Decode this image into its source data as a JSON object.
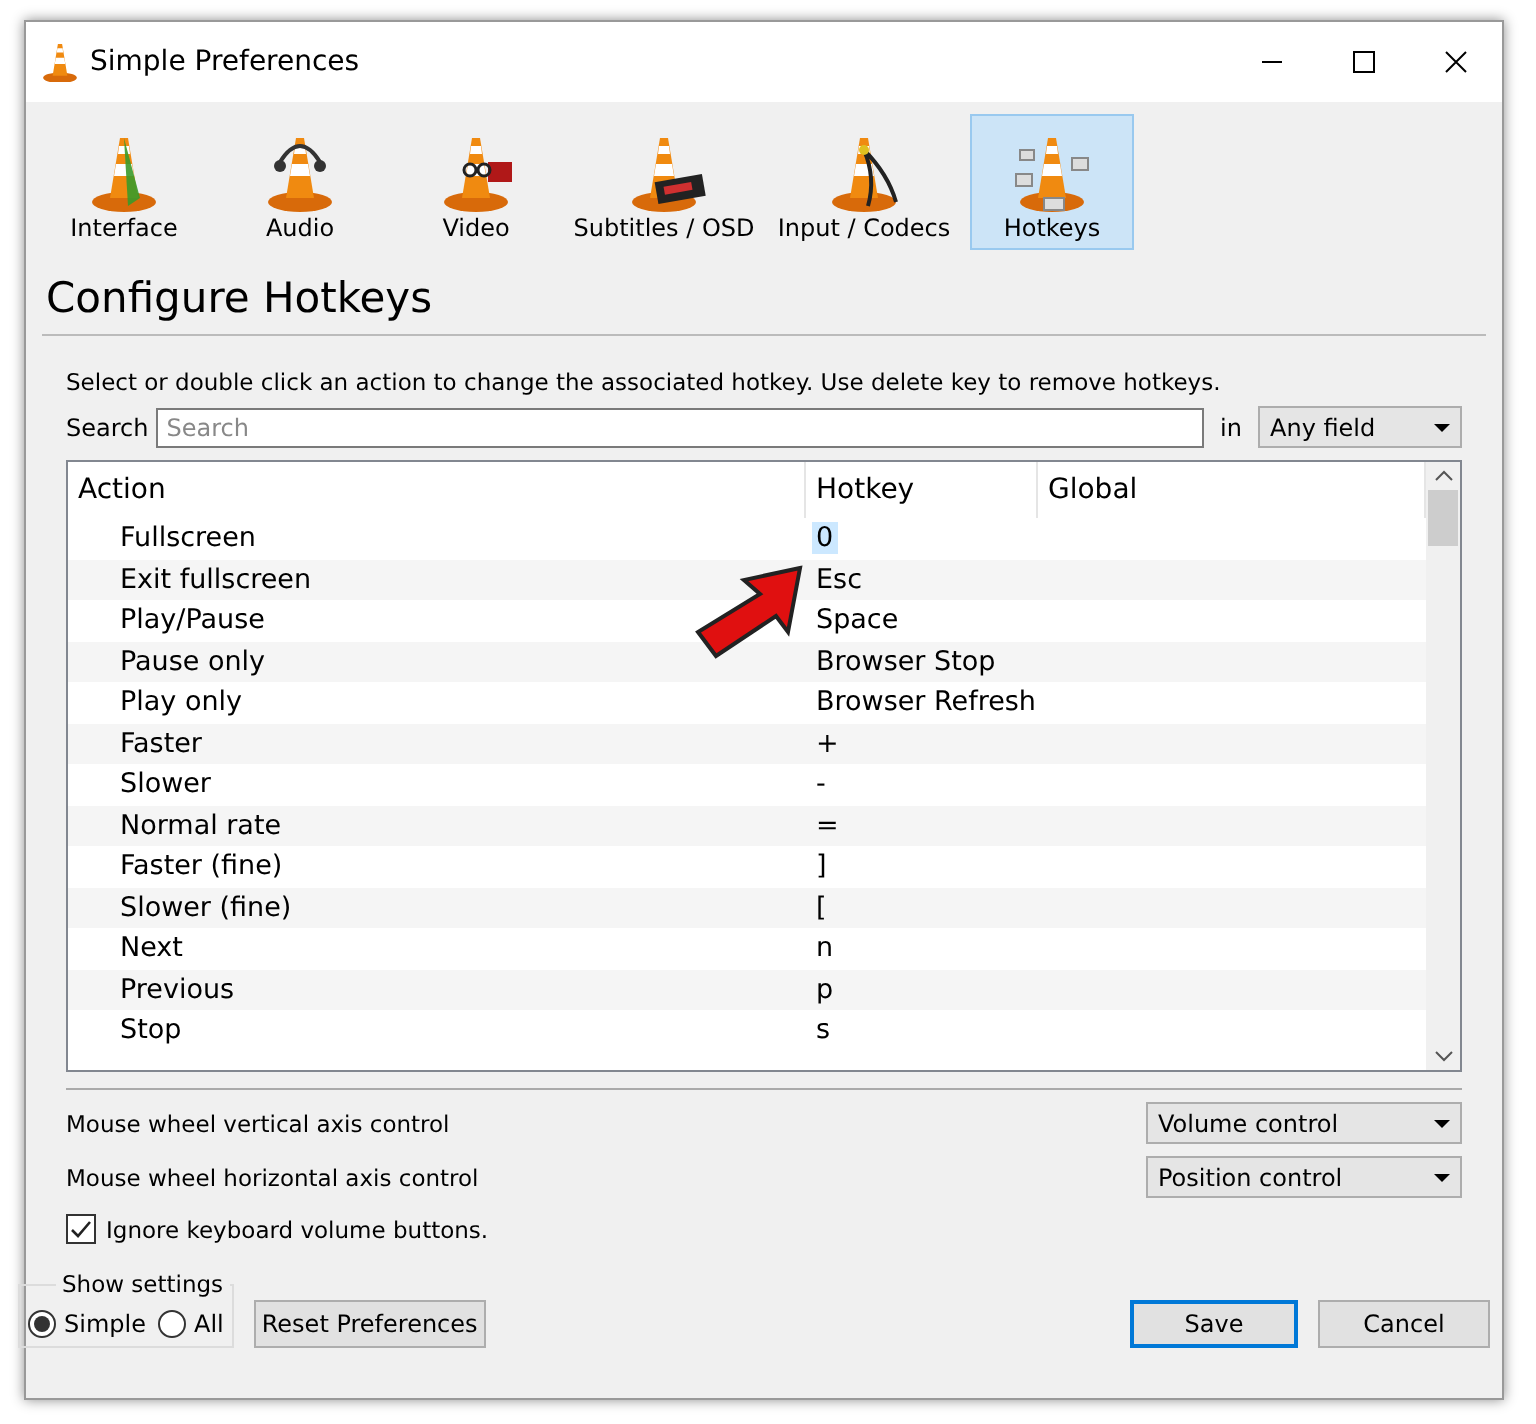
{
  "window": {
    "title": "Simple Preferences"
  },
  "categories": [
    {
      "label": "Interface",
      "kind": "interface",
      "selected": false
    },
    {
      "label": "Audio",
      "kind": "audio",
      "selected": false
    },
    {
      "label": "Video",
      "kind": "video",
      "selected": false
    },
    {
      "label": "Subtitles / OSD",
      "kind": "subtitles",
      "selected": false
    },
    {
      "label": "Input / Codecs",
      "kind": "input",
      "selected": false
    },
    {
      "label": "Hotkeys",
      "kind": "hotkeys",
      "selected": true
    }
  ],
  "heading": "Configure Hotkeys",
  "instructions": "Select or double click an action to change the associated hotkey. Use delete key to remove hotkeys.",
  "search": {
    "label": "Search",
    "placeholder": "Search",
    "in_label": "in",
    "field": "Any field"
  },
  "table": {
    "columns": [
      "Action",
      "Hotkey",
      "Global"
    ],
    "rows": [
      {
        "action": "Fullscreen",
        "hotkey": "0",
        "selected": true
      },
      {
        "action": "Exit fullscreen",
        "hotkey": "Esc",
        "selected": false
      },
      {
        "action": "Play/Pause",
        "hotkey": "Space",
        "selected": false
      },
      {
        "action": "Pause only",
        "hotkey": "Browser Stop",
        "selected": false
      },
      {
        "action": "Play only",
        "hotkey": "Browser Refresh",
        "selected": false
      },
      {
        "action": "Faster",
        "hotkey": "+",
        "selected": false
      },
      {
        "action": "Slower",
        "hotkey": "-",
        "selected": false
      },
      {
        "action": "Normal rate",
        "hotkey": "=",
        "selected": false
      },
      {
        "action": "Faster (fine)",
        "hotkey": "]",
        "selected": false
      },
      {
        "action": "Slower (fine)",
        "hotkey": "[",
        "selected": false
      },
      {
        "action": "Next",
        "hotkey": "n",
        "selected": false
      },
      {
        "action": "Previous",
        "hotkey": "p",
        "selected": false
      },
      {
        "action": "Stop",
        "hotkey": "s",
        "selected": false
      }
    ]
  },
  "mouse_settings": [
    {
      "label": "Mouse wheel vertical axis control",
      "value": "Volume control"
    },
    {
      "label": "Mouse wheel horizontal axis control",
      "value": "Position control"
    }
  ],
  "ignore_volume_buttons": {
    "label": "Ignore keyboard volume buttons.",
    "checked": true
  },
  "show_settings": {
    "title": "Show settings",
    "options": [
      {
        "label": "Simple",
        "selected": true
      },
      {
        "label": "All",
        "selected": false
      }
    ]
  },
  "buttons": {
    "reset": "Reset Preferences",
    "save": "Save",
    "cancel": "Cancel"
  }
}
